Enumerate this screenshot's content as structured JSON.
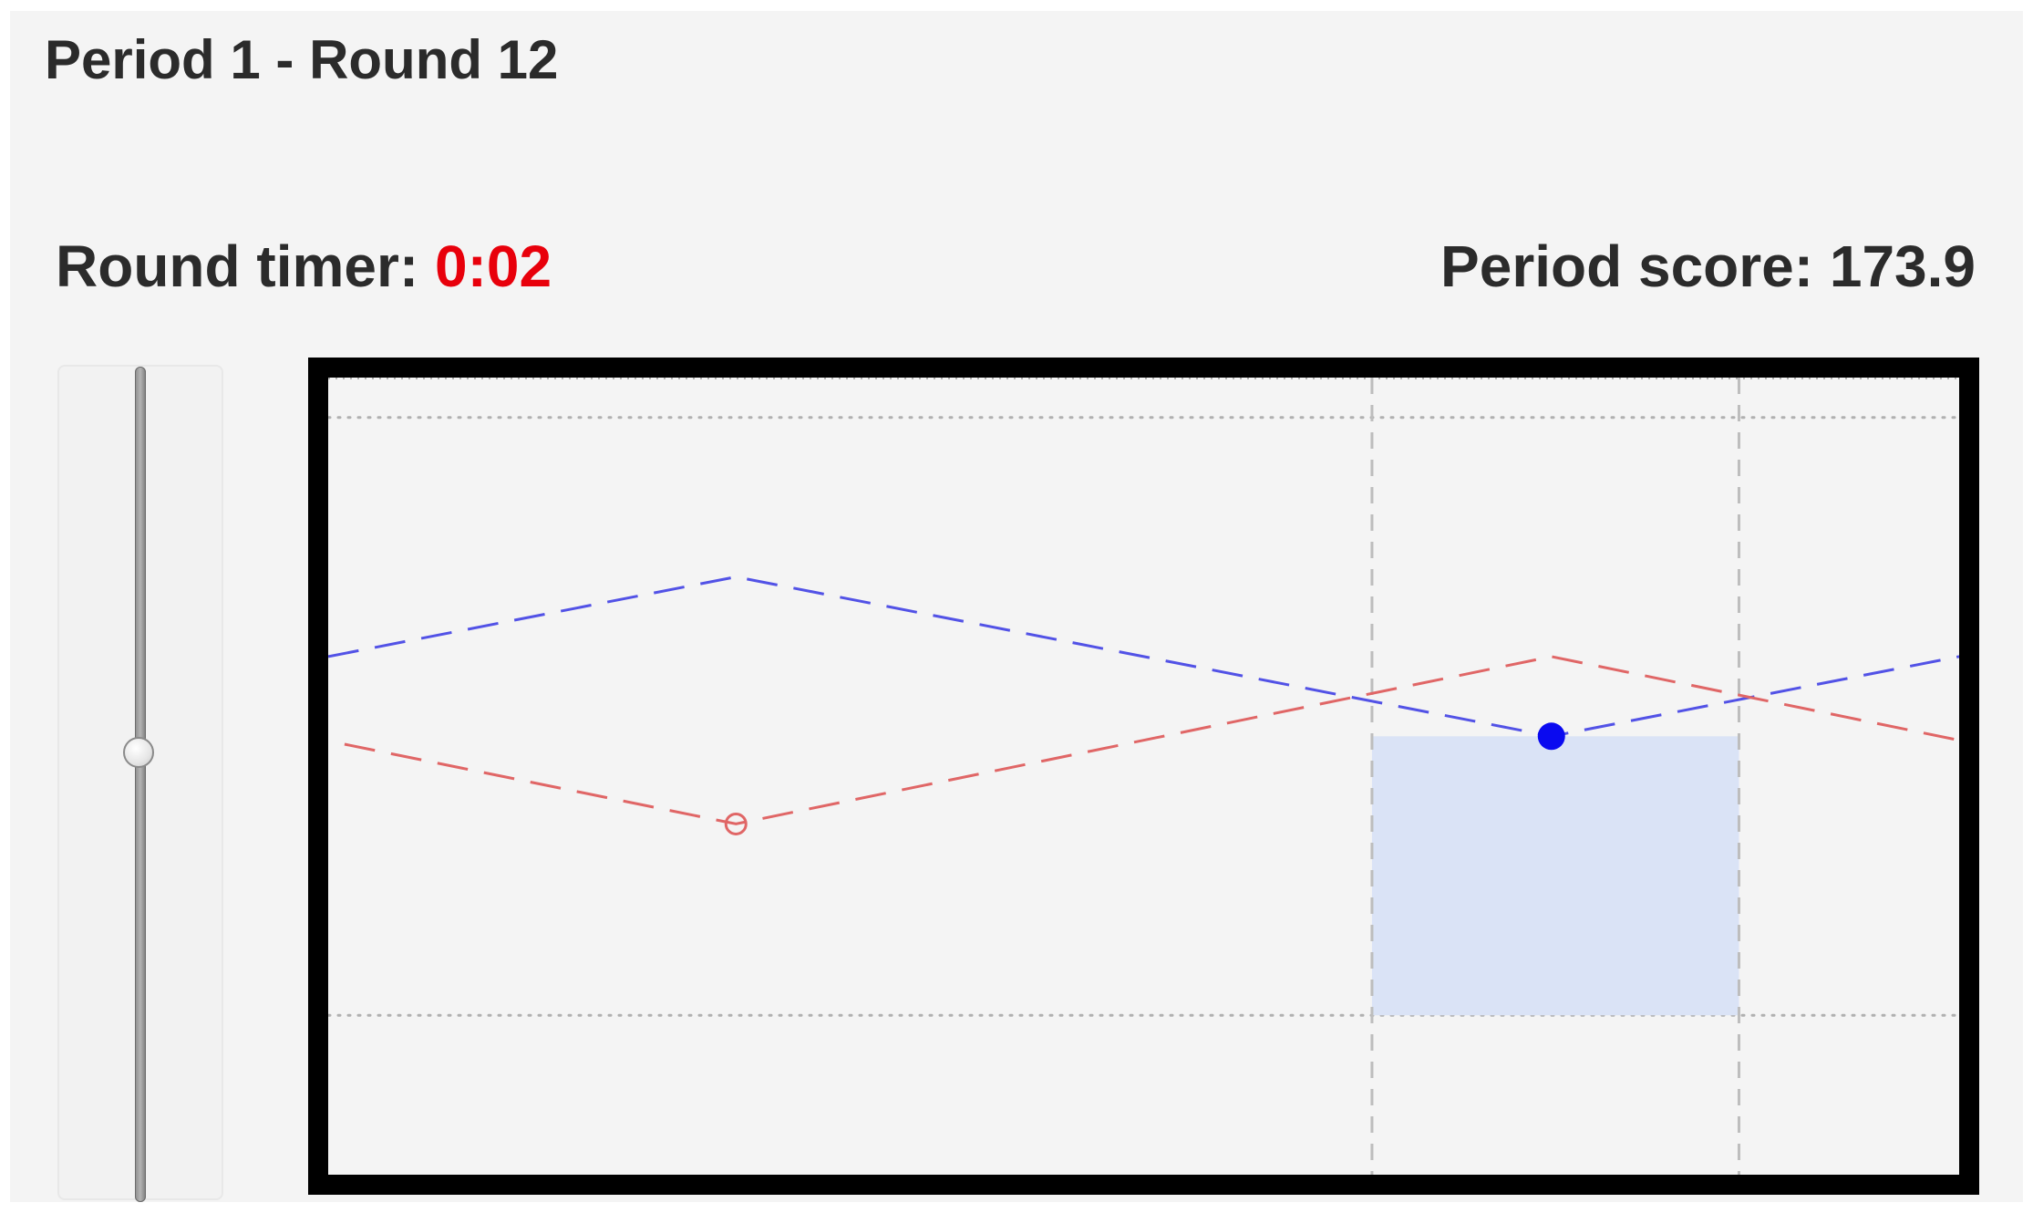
{
  "header": {
    "title": "Period 1 - Round 12"
  },
  "status": {
    "timer_label": "Round timer: ",
    "timer_value": "0:02",
    "timer_color": "#e8000b",
    "score_label": "Period score: ",
    "score_value": "173.9"
  },
  "slider": {
    "orientation": "vertical",
    "value_fraction": 0.54
  },
  "colors": {
    "panel_bg": "#f4f4f4",
    "frame": "#000000",
    "blue_line": "#5252e6",
    "red_line": "#e06666",
    "highlight": "#dae3f6",
    "gridline": "#b0b0b0"
  },
  "chart_data": {
    "type": "line",
    "title": "",
    "xlabel": "",
    "ylabel": "",
    "xlim": [
      0,
      100
    ],
    "ylim": [
      0,
      100
    ],
    "grid": "dotted horizontal lines at y=20 and y=95",
    "highlight_band": {
      "x_start": 64,
      "x_end": 86.5,
      "y_top": 55
    },
    "vertical_markers": [
      64,
      86.5
    ],
    "series": [
      {
        "color": "#5252e6",
        "style": "dashed",
        "marker": "filled-circle",
        "marker_point": [
          75,
          55
        ],
        "points": [
          [
            0,
            65
          ],
          [
            25,
            75
          ],
          [
            75,
            55
          ],
          [
            100,
            65
          ]
        ]
      },
      {
        "color": "#e06666",
        "style": "dashed",
        "marker": "open-circle",
        "marker_point": [
          25,
          44
        ],
        "points": [
          [
            1,
            54
          ],
          [
            25,
            44
          ],
          [
            75,
            65
          ],
          [
            100,
            54.5
          ]
        ]
      }
    ]
  }
}
